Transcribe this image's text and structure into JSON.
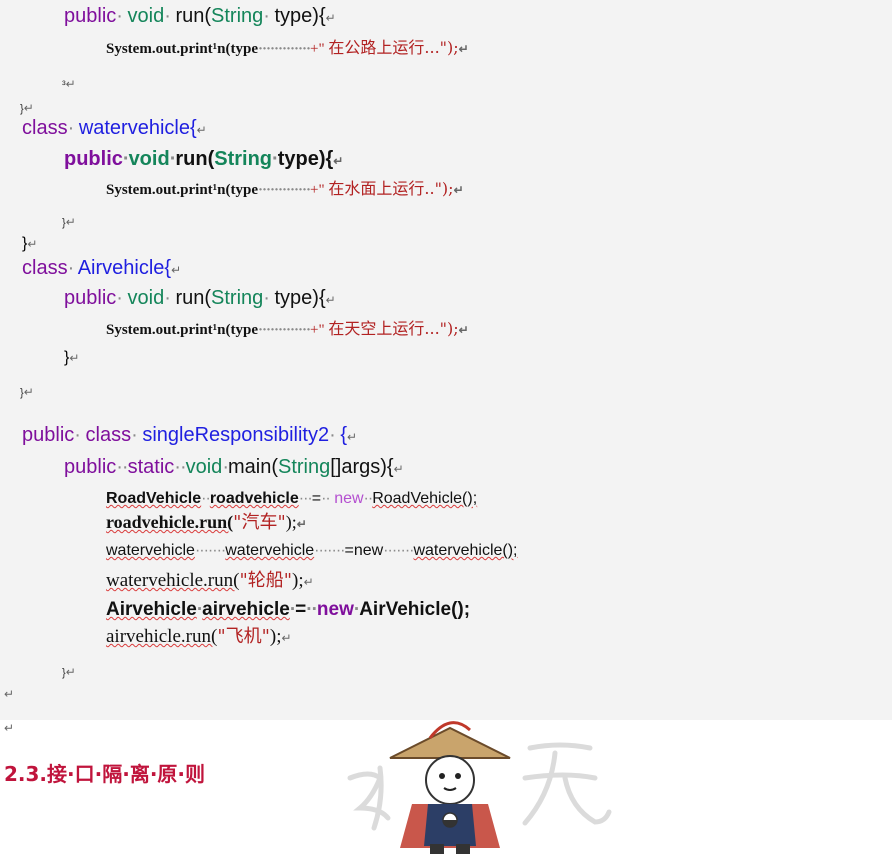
{
  "lines": {
    "l1": {
      "kw": "public",
      "void": "void",
      "run": "run(",
      "type": "String",
      "arg": "type){"
    },
    "l2": {
      "code": "System.out.print¹n(type",
      "plus": "+\"",
      "cn": "在公路上运行...\");"
    },
    "l3": {
      "brace": "³"
    },
    "l4": {
      "brace": "}"
    },
    "l5": {
      "kw": "class",
      "name": "watervehicle{"
    },
    "l6": {
      "kw": "public",
      "void": "void",
      "run": "run(",
      "type": "String",
      "arg": "type){"
    },
    "l7": {
      "code": "System.out.print¹n(type",
      "plus": "+\"",
      "cn": "在水面上运行..\");"
    },
    "l8": {
      "brace": "}"
    },
    "l9": {
      "brace": "}"
    },
    "l10": {
      "kw": "class",
      "name": "Airvehicle{"
    },
    "l11": {
      "kw": "public",
      "void": "void",
      "run": "run(",
      "type": "String",
      "arg": "type){"
    },
    "l12": {
      "code": "System.out.print¹n(type",
      "plus": "+\"",
      "cn": "在天空上运行...\");"
    },
    "l13": {
      "brace": "}"
    },
    "l14": {
      "brace": "}"
    },
    "l15": {
      "kw": "public",
      "kw2": "class",
      "name": "singleResponsibility2",
      "brace": "{"
    },
    "l16": {
      "kw": "public",
      "static": "static",
      "void": "void",
      "main": "main(",
      "type": "String",
      "args": "[]args){"
    },
    "l17": {
      "cls": "RoadVehicle",
      "var": "roadvehicle",
      "eq": "=",
      "new": "new",
      "ctor": "RoadVehicle();"
    },
    "l18": {
      "code": "roadvehicle.run(",
      "cn": "\"汽车\"",
      "end": ");"
    },
    "l19": {
      "a": "watervehicle",
      "b": "watervehicle",
      "c": "=new",
      "d": "watervehicle();"
    },
    "l20": {
      "code": "watervehicle.run(",
      "cn": "\"轮船\"",
      "end": ");"
    },
    "l21": {
      "cls": "Airvehicle",
      "var": "airvehicle",
      "eq": "=",
      "new": "new",
      "ctor": "AirVehicle();"
    },
    "l22": {
      "code": "airvehicle.run(",
      "cn": "\"飞机\"",
      "end": ");"
    },
    "l23": {
      "brace": "}"
    }
  },
  "heading": "2.3.接·口·隔·离·原·则",
  "watermark_text": "张无忌"
}
